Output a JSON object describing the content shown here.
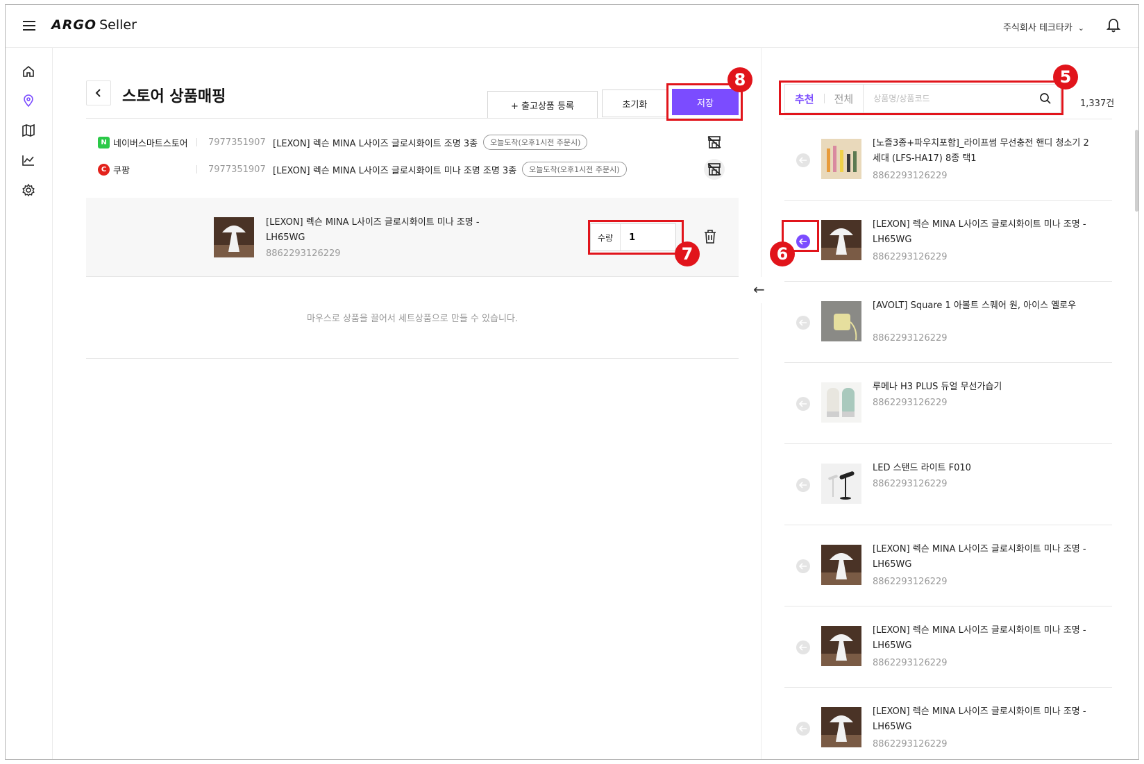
{
  "header": {
    "logo": "ARGO",
    "logo_suffix": "Seller",
    "company": "주식회사 테크타카"
  },
  "sidebar": {
    "items": [
      "home-icon",
      "location-pin-icon",
      "map-icon",
      "chart-icon",
      "settings-icon"
    ]
  },
  "page": {
    "title": "스토어 상품매핑",
    "register_label": "+ 출고상품 등록",
    "reset_label": "초기화",
    "save_label": "저장"
  },
  "mappings": [
    {
      "store": "네이버스마트스토어",
      "badge": "N",
      "code": "7977351907",
      "name": "[LEXON] 렉슨 MINA L사이즈 글로시화이트 조명 3종",
      "tag": "오늘도착(오후1시전 주문시)"
    },
    {
      "store": "쿠팡",
      "badge": "C",
      "code": "7977351907",
      "name": "[LEXON] 렉슨 MINA L사이즈 글로시화이트 미나 조명 조명 3종",
      "tag": "오늘도착(오후1시전 주문시)"
    }
  ],
  "set_item": {
    "name": "[LEXON] 렉슨 MINA L사이즈 글로시화이트 미나 조명 - LH65WG",
    "code": "8862293126229",
    "qty_label": "수량",
    "qty_value": "1"
  },
  "drop_hint": "마우스로 상품을 끌어서 세트상품으로 만들 수 있습니다.",
  "right_panel": {
    "tab_recommended": "추천",
    "tab_all": "전체",
    "search_placeholder": "상품명/상품코드",
    "count": "1,337건",
    "products": [
      {
        "name": "[노즐3종+파우치포함]_라이프썸 무선충전 핸디 청소기 2세대 (LFS-HA17) 8종 택1",
        "code": "8862293126229",
        "thumb": "vacuum"
      },
      {
        "name": "[LEXON] 렉슨 MINA L사이즈 글로시화이트 미나 조명 - LH65WG",
        "code": "8862293126229",
        "thumb": "lamp"
      },
      {
        "name": "[AVOLT] Square 1 아볼트 스퀘어 원, 아이스 옐로우",
        "code": "8862293126229",
        "thumb": "charger"
      },
      {
        "name": "루메나 H3 PLUS 듀얼 무선가습기",
        "code": "8862293126229",
        "thumb": "humidifier"
      },
      {
        "name": "LED 스탠드 라이트 F010",
        "code": "8862293126229",
        "thumb": "standlight"
      },
      {
        "name": "[LEXON] 렉슨 MINA L사이즈 글로시화이트 미나 조명 - LH65WG",
        "code": "8862293126229",
        "thumb": "lamp"
      },
      {
        "name": "[LEXON] 렉슨 MINA L사이즈 글로시화이트 미나 조명 - LH65WG",
        "code": "8862293126229",
        "thumb": "lamp"
      },
      {
        "name": "[LEXON] 렉슨 MINA L사이즈 글로시화이트 미나 조명 - LH65WG",
        "code": "8862293126229",
        "thumb": "lamp"
      }
    ]
  },
  "annotations": [
    "5",
    "6",
    "7",
    "8"
  ],
  "colors": {
    "accent": "#7b4cff",
    "annotation": "#e1141b",
    "naver": "#2bc948",
    "coupang": "#e3221b"
  }
}
